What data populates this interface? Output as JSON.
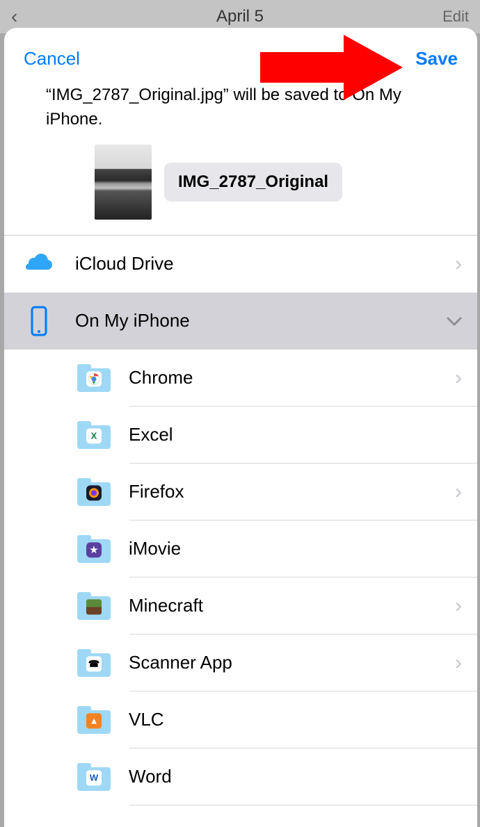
{
  "backdrop": {
    "title": "April 5",
    "edit": "Edit"
  },
  "header": {
    "cancel": "Cancel",
    "save": "Save"
  },
  "message": "“IMG_2787_Original.jpg” will be saved to On My iPhone.",
  "file": {
    "name": "IMG_2787_Original"
  },
  "locations": [
    {
      "id": "icloud",
      "label": "iCloud Drive",
      "selected": false,
      "expandable": true,
      "expanded": false
    },
    {
      "id": "onmyiphone",
      "label": "On My iPhone",
      "selected": true,
      "expandable": true,
      "expanded": true
    }
  ],
  "subfolders": [
    {
      "id": "chrome",
      "label": "Chrome",
      "disclosure": true
    },
    {
      "id": "excel",
      "label": "Excel",
      "disclosure": false
    },
    {
      "id": "firefox",
      "label": "Firefox",
      "disclosure": true
    },
    {
      "id": "imovie",
      "label": "iMovie",
      "disclosure": false
    },
    {
      "id": "minecraft",
      "label": "Minecraft",
      "disclosure": true
    },
    {
      "id": "scanner",
      "label": "Scanner App",
      "disclosure": true
    },
    {
      "id": "vlc",
      "label": "VLC",
      "disclosure": false
    },
    {
      "id": "word",
      "label": "Word",
      "disclosure": false
    }
  ],
  "colors": {
    "accent": "#007aff",
    "arrowRed": "#ff0000"
  }
}
